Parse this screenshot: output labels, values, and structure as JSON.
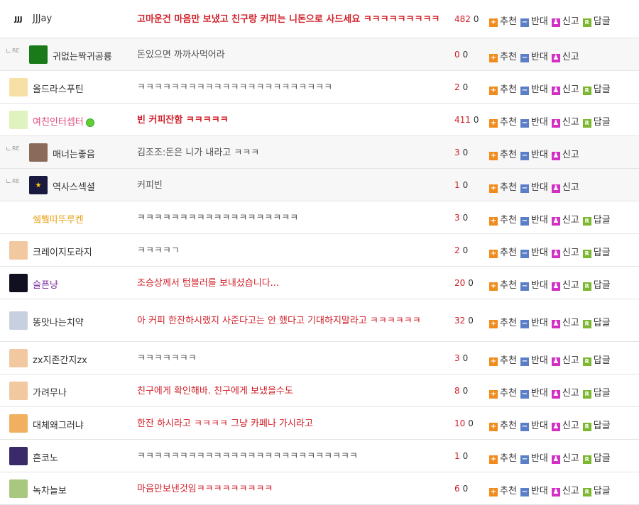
{
  "comments": [
    {
      "name": "JJJay",
      "name_color": "#333333",
      "avatar_text": "JJJ",
      "avatar_bg": "#ffffff",
      "avatar_fg": "#111111",
      "content": "고마운건 마음만 보냈고 친구랑 커피는 니돈으로 사드세요 ㅋㅋㅋㅋㅋㅋㅋㅋㅋ",
      "style": "best",
      "up": "482",
      "down": "0",
      "reply": false,
      "can_reply": true
    },
    {
      "name": "귀없는짝귀공룡",
      "name_color": "#333333",
      "avatar_text": "",
      "avatar_bg": "#1a7a1a",
      "avatar_fg": "#44ff44",
      "content": "돈있으면 까까사먹어라",
      "style": "normal",
      "up": "0",
      "down": "0",
      "reply": true,
      "can_reply": false
    },
    {
      "name": "올드라스푸틴",
      "name_color": "#333333",
      "avatar_text": "",
      "avatar_bg": "#f6e0a6",
      "avatar_fg": "#8a5a20",
      "content": "ㅋㅋㅋㅋㅋㅋㅋㅋㅋㅋㅋㅋㅋㅋㅋㅋㅋㅋㅋㅋㅋㅋㅋ",
      "style": "normal",
      "up": "2",
      "down": "0",
      "reply": false,
      "can_reply": true
    },
    {
      "name": "여친인터셉터",
      "name_color": "#e0457b",
      "avatar_text": "",
      "avatar_bg": "#dff2c0",
      "avatar_fg": "#6a9a3a",
      "content": "빈 커피잔함 ㅋㅋㅋㅋㅋ",
      "style": "best",
      "up": "411",
      "down": "0",
      "reply": false,
      "can_reply": true,
      "level_badge": true
    },
    {
      "name": "매너는좋음",
      "name_color": "#333333",
      "avatar_text": "",
      "avatar_bg": "#8a6a5a",
      "avatar_fg": "#ffffff",
      "content": "김조조:돈은 니가 내라고 ㅋㅋㅋ",
      "style": "normal",
      "up": "3",
      "down": "0",
      "reply": true,
      "can_reply": false
    },
    {
      "name": "역사스섹셜",
      "name_color": "#333333",
      "avatar_text": "★",
      "avatar_bg": "#1a1a40",
      "avatar_fg": "#ffd400",
      "content": "커피빈",
      "style": "normal",
      "up": "1",
      "down": "0",
      "reply": true,
      "can_reply": false
    },
    {
      "name": "쉨쀀따뚜루켄",
      "name_color": "#e8a21a",
      "avatar_text": "",
      "avatar_bg": "#ffffff",
      "avatar_fg": "#888888",
      "content": "ㅋㅋㅋㅋㅋㅋㅋㅋㅋㅋㅋㅋㅋㅋㅋㅋㅋㅋㅋ",
      "style": "normal",
      "up": "3",
      "down": "0",
      "reply": false,
      "can_reply": true
    },
    {
      "name": "크레이지도라지",
      "name_color": "#333333",
      "avatar_text": "",
      "avatar_bg": "#f2c8a0",
      "avatar_fg": "#333333",
      "content": "ㅋㅋㅋㅋㄱ",
      "style": "normal",
      "up": "2",
      "down": "0",
      "reply": false,
      "can_reply": true
    },
    {
      "name": "슬픈냥",
      "name_color": "#7a2aa0",
      "avatar_text": "",
      "avatar_bg": "#101020",
      "avatar_fg": "#8fd0ff",
      "content": "조승상께서 텀블러를 보내셨습니다...",
      "style": "red",
      "up": "20",
      "down": "0",
      "reply": false,
      "can_reply": true
    },
    {
      "name": "똥맛나는치약",
      "name_color": "#333333",
      "avatar_text": "",
      "avatar_bg": "#c8d0e0",
      "avatar_fg": "#203060",
      "content": "아 커피 한잔하시랬지 사준다고는 안 했다고 기대하지말라고 ㅋㅋㅋㅋㅋㅋ",
      "style": "red",
      "up": "32",
      "down": "0",
      "reply": false,
      "can_reply": true,
      "tall": true
    },
    {
      "name": "zx지존간지zx",
      "name_color": "#333333",
      "avatar_text": "",
      "avatar_bg": "#f2c8a0",
      "avatar_fg": "#333333",
      "content": "ㅋㅋㅋㅋㅋㅋㅋ",
      "style": "normal",
      "up": "3",
      "down": "0",
      "reply": false,
      "can_reply": true
    },
    {
      "name": "가려무나",
      "name_color": "#333333",
      "avatar_text": "",
      "avatar_bg": "#f2c8a0",
      "avatar_fg": "#333333",
      "content": "친구에게 확인해바. 친구에게 보냈을수도",
      "style": "red",
      "up": "8",
      "down": "0",
      "reply": false,
      "can_reply": true
    },
    {
      "name": "대체왜그러냐",
      "name_color": "#333333",
      "avatar_text": "",
      "avatar_bg": "#f0b060",
      "avatar_fg": "#ffffff",
      "content": "한잔 하시라고 ㅋㅋㅋㅋ 그냥 카페나 가시라고",
      "style": "red",
      "up": "10",
      "down": "0",
      "reply": false,
      "can_reply": true
    },
    {
      "name": "흔코노",
      "name_color": "#333333",
      "avatar_text": "",
      "avatar_bg": "#3a2a6a",
      "avatar_fg": "#c0a0ff",
      "content": "ㅋㅋㅋㅋㅋㅋㅋㅋㅋㅋㅋㅋㅋㅋㅋㅋㅋㅋㅋㅋㅋㅋㅋㅋㅋㅋ",
      "style": "normal",
      "up": "1",
      "down": "0",
      "reply": false,
      "can_reply": true
    },
    {
      "name": "녹차늘보",
      "name_color": "#333333",
      "avatar_text": "",
      "avatar_bg": "#a8c880",
      "avatar_fg": "#5a3a20",
      "content": "마음만보낸것임ㅋㅋㅋㅋㅋㅋㅋㅋㅋ",
      "style": "red",
      "up": "6",
      "down": "0",
      "reply": false,
      "can_reply": true
    }
  ],
  "labels": {
    "recommend": "추천",
    "oppose": "반대",
    "report": "신고",
    "reply": "답글",
    "re_mark": "RE"
  },
  "icons": {
    "recommend": "plus-icon",
    "oppose": "minus-icon",
    "report": "report-icon",
    "reply": "reply-icon"
  },
  "colors": {
    "best_text": "#d0212a",
    "up_count": "#d0212a",
    "recommend_icon": "#f08c1c",
    "oppose_icon": "#5b7fc7",
    "report_icon": "#d42fc4",
    "reply_icon": "#7cb82f"
  }
}
